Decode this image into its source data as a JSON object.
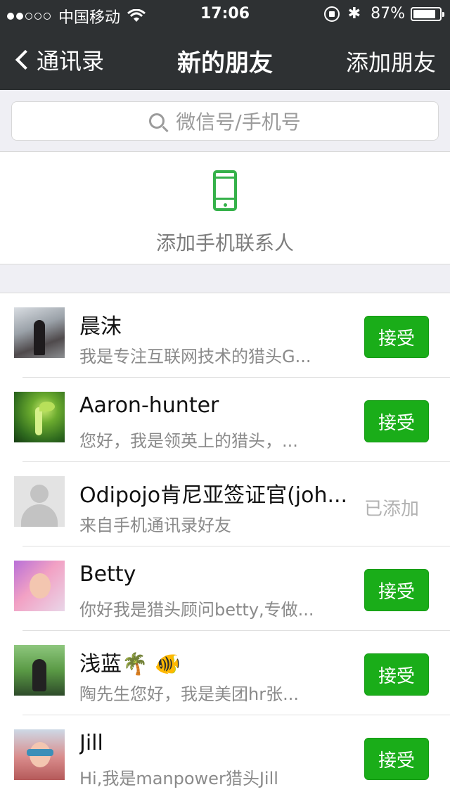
{
  "status_bar": {
    "signal_dots": [
      true,
      true,
      false,
      false,
      false
    ],
    "carrier": "中国移动",
    "time": "17:06",
    "battery_pct": "87%",
    "battery_level": 0.87
  },
  "nav": {
    "back_label": "通讯录",
    "title": "新的朋友",
    "add_label": "添加朋友"
  },
  "search": {
    "placeholder": "微信号/手机号"
  },
  "phone_contacts": {
    "label": "添加手机联系人"
  },
  "requests": [
    {
      "name": "晨沫",
      "message": "我是专注互联网技术的猎头G...",
      "action": "接受",
      "state": "pending"
    },
    {
      "name": "Aaron-hunter",
      "message": "您好，我是领英上的猎头，...",
      "action": "接受",
      "state": "pending"
    },
    {
      "name": "Odipojo肯尼亚签证官(joh...",
      "message": "来自手机通讯录好友",
      "action": "已添加",
      "state": "added"
    },
    {
      "name": "Betty",
      "message": "你好我是猎头顾问betty,专做...",
      "action": "接受",
      "state": "pending"
    },
    {
      "name": "浅蓝🌴 🐠",
      "message": "陶先生您好，我是美团hr张...",
      "action": "接受",
      "state": "pending"
    },
    {
      "name": "Jill",
      "message": "Hi,我是manpower猎头Jill",
      "action": "接受",
      "state": "pending"
    }
  ],
  "colors": {
    "nav_bg": "#2e3133",
    "accept_green": "#1aad19",
    "phone_icon_green": "#35b14a"
  }
}
